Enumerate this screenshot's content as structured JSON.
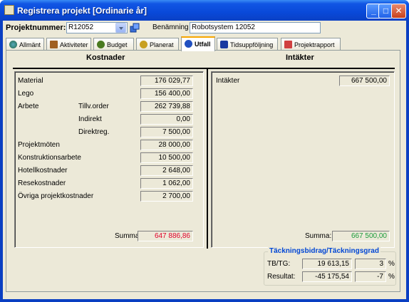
{
  "window": {
    "title": "Registrera projekt [Ordinarie år]"
  },
  "header": {
    "project_number_label": "Projektnummer:",
    "project_number_value": "R12052",
    "name_label": "Benämning",
    "name_value": "Robotsystem 12052"
  },
  "tabs": [
    {
      "label": "Allmänt",
      "icon": "globe-icon"
    },
    {
      "label": "Aktiviteter",
      "icon": "activities-icon"
    },
    {
      "label": "Budget",
      "icon": "money-bag-icon"
    },
    {
      "label": "Planerat",
      "icon": "money-bag-icon"
    },
    {
      "label": "Utfall",
      "icon": "outcome-icon",
      "active": true
    },
    {
      "label": "Tidsuppföljning",
      "icon": "time-icon"
    },
    {
      "label": "Projektrapport",
      "icon": "report-icon"
    }
  ],
  "costs": {
    "heading": "Kostnader",
    "rows": [
      {
        "label": "Material",
        "sub": "",
        "value": "176 029,77"
      },
      {
        "label": "Lego",
        "sub": "",
        "value": "156 400,00"
      },
      {
        "label": "Arbete",
        "sub": "Tillv.order",
        "value": "262 739,88"
      },
      {
        "label": "",
        "sub": "Indirekt",
        "value": "0,00"
      },
      {
        "label": "",
        "sub": "Direktreg.",
        "value": "7 500,00"
      },
      {
        "label": "Projektmöten",
        "sub": "",
        "value": "28 000,00"
      },
      {
        "label": "Konstruktionsarbete",
        "sub": "",
        "value": "10 500,00"
      },
      {
        "label": "Hotellkostnader",
        "sub": "",
        "value": "2 648,00"
      },
      {
        "label": "Resekostnader",
        "sub": "",
        "value": "1 062,00"
      },
      {
        "label": "Övriga projektkostnader",
        "sub": "",
        "value": "2 700,00"
      }
    ],
    "sum_label": "Summa:",
    "sum_value": "647 886,86",
    "sum_color": "#e0002a"
  },
  "income": {
    "heading": "Intäkter",
    "row_label": "Intäkter",
    "row_value": "667 500,00",
    "sum_label": "Summa:",
    "sum_value": "667 500,00",
    "sum_color": "#1a9a3a"
  },
  "margin": {
    "title": "Täckningsbidrag/Täckningsgrad",
    "tbtg_label": "TB/TG:",
    "tbtg_value": "19 613,15",
    "tbtg_pct": "3",
    "result_label": "Resultat:",
    "result_value": "-45 175,54",
    "result_pct": "-7",
    "pct_sign": "%"
  }
}
